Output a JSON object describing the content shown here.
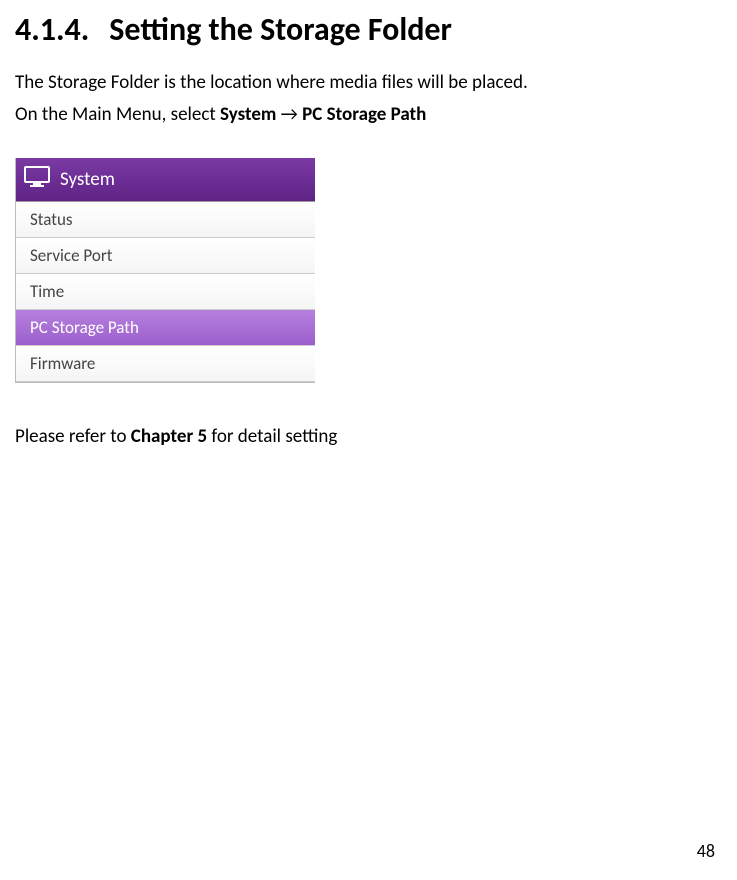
{
  "heading": {
    "number": "4.1.4.",
    "title": "Setting the Storage Folder"
  },
  "intro": {
    "line1": "The Storage Folder is the location where media files will be placed.",
    "line2_pre": "On the Main Menu, select ",
    "line2_bold_a": "System",
    "line2_arrow": " → ",
    "line2_bold_b": "PC Storage Path"
  },
  "menu": {
    "header": "System",
    "items": [
      {
        "label": "Status",
        "selected": false
      },
      {
        "label": "Service Port",
        "selected": false
      },
      {
        "label": "Time",
        "selected": false
      },
      {
        "label": "PC Storage Path",
        "selected": true
      },
      {
        "label": "Firmware",
        "selected": false
      }
    ]
  },
  "footer": {
    "pre": "Please refer to ",
    "bold": "Chapter 5",
    "post": " for detail setting"
  },
  "page_number": "48"
}
